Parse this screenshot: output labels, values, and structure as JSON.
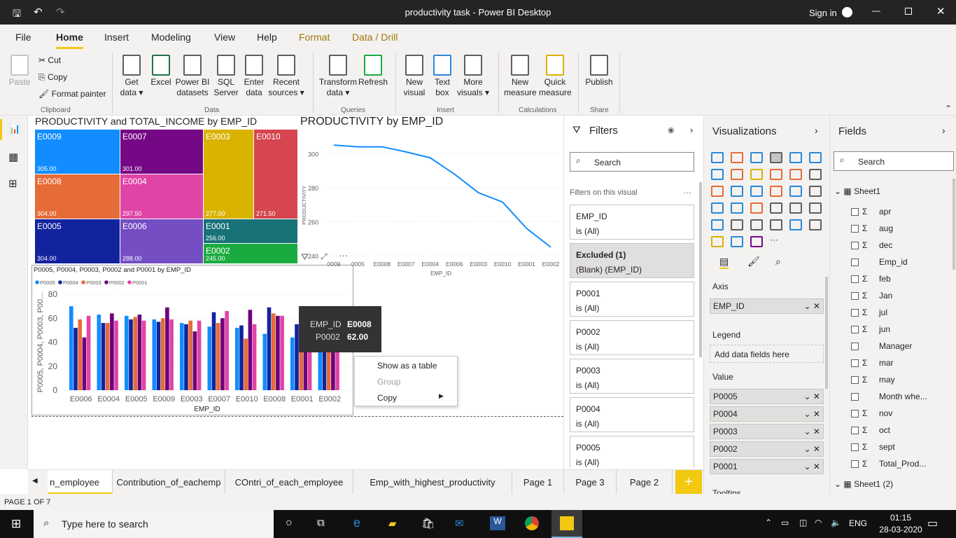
{
  "window": {
    "title": "productivity task - Power BI Desktop",
    "sign_in": "Sign in"
  },
  "tabs": [
    "File",
    "Home",
    "Insert",
    "Modeling",
    "View",
    "Help",
    "Format",
    "Data / Drill"
  ],
  "ribbon": {
    "clipboard": {
      "paste": "Paste",
      "cut": "Cut",
      "copy": "Copy",
      "format_painter": "Format painter",
      "group": "Clipboard"
    },
    "data": {
      "items": [
        "Get data",
        "Excel",
        "Power BI datasets",
        "SQL Server",
        "Enter data",
        "Recent sources"
      ],
      "group": "Data"
    },
    "queries": {
      "items": [
        "Transform data",
        "Refresh"
      ],
      "group": "Queries"
    },
    "insert": {
      "items": [
        "New visual",
        "Text box",
        "More visuals"
      ],
      "group": "Insert"
    },
    "calculations": {
      "items": [
        "New measure",
        "Quick measure"
      ],
      "group": "Calculations"
    },
    "share": {
      "items": [
        "Publish"
      ],
      "group": "Share"
    }
  },
  "treemap": {
    "title": "PRODUCTIVITY and TOTAL_INCOME by EMP_ID",
    "tiles": [
      {
        "id": "E0009",
        "value": "305.00",
        "color": "#118dff"
      },
      {
        "id": "E0007",
        "value": "301.00",
        "color": "#750985"
      },
      {
        "id": "E0003",
        "value": "277.00",
        "color": "#d9b300"
      },
      {
        "id": "E0010",
        "value": "271.50",
        "color": "#d64550"
      },
      {
        "id": "E0008",
        "value": "304.00",
        "color": "#e66c37"
      },
      {
        "id": "E0004",
        "value": "297.50",
        "color": "#e044a7"
      },
      {
        "id": "E0001",
        "value": "256.00",
        "color": "#197278"
      },
      {
        "id": "E0005",
        "value": "304.00",
        "color": "#12239e"
      },
      {
        "id": "E0006",
        "value": "288.00",
        "color": "#744ec2"
      },
      {
        "id": "E0002",
        "value": "245.00",
        "color": "#1aab40"
      }
    ]
  },
  "chart_data": [
    {
      "type": "line",
      "title": "PRODUCTIVITY by EMP_ID",
      "xlabel": "EMP_ID",
      "ylabel": "PRODUCTIVITY",
      "categories": [
        "E0009",
        "E0005",
        "E0008",
        "E0007",
        "E0004",
        "E0006",
        "E0003",
        "E0010",
        "E0001",
        "E0002"
      ],
      "tick_labels": [
        "0009",
        "0005",
        "E0008",
        "E0007",
        "E0004",
        "E0006",
        "E0003",
        "E0010",
        "E0001",
        "E0002"
      ],
      "values": [
        305,
        304,
        304,
        301,
        297.5,
        288,
        277,
        271.5,
        256,
        245
      ],
      "ylim": [
        240,
        310
      ],
      "yticks": [
        "240",
        "260",
        "280",
        "300"
      ],
      "grid": true,
      "color": "#118dff"
    },
    {
      "type": "bar",
      "title": "P0005, P0004, P0003, P0002 and P0001 by EMP_ID",
      "xlabel": "EMP_ID",
      "ylabel": "P0005, P0004, P0003, P00...",
      "categories": [
        "E0006",
        "E0004",
        "E0005",
        "E0009",
        "E0003",
        "E0007",
        "E0010",
        "E0008",
        "E0001",
        "E0002"
      ],
      "ylim": [
        0,
        80
      ],
      "yticks": [
        "0",
        "20",
        "40",
        "60",
        "80"
      ],
      "grid": true,
      "legend": "top-left",
      "series": [
        {
          "name": "P0005",
          "color": "#118dff",
          "values": [
            70,
            63,
            62,
            59,
            56,
            53,
            52,
            47,
            44,
            45
          ]
        },
        {
          "name": "P0004",
          "color": "#12239e",
          "values": [
            52,
            56,
            59,
            57,
            55,
            65,
            54,
            69,
            55,
            52
          ]
        },
        {
          "name": "P0003",
          "color": "#e66c37",
          "values": [
            59,
            56,
            61,
            60,
            58,
            56,
            43,
            64,
            50,
            50
          ]
        },
        {
          "name": "P0002",
          "color": "#6b007b",
          "values": [
            44,
            64,
            63,
            69,
            49,
            60,
            67,
            62,
            57,
            56
          ]
        },
        {
          "name": "P0001",
          "color": "#e044a7",
          "values": [
            62,
            58,
            58,
            59,
            58,
            66,
            55,
            62,
            55,
            54
          ]
        }
      ]
    }
  ],
  "tooltip": {
    "k1": "EMP_ID",
    "v1": "E0008",
    "k2": "P0002",
    "v2": "62.00"
  },
  "context_menu": [
    "Show as a table",
    "Group",
    "Copy"
  ],
  "filters": {
    "title": "Filters",
    "search": "Search",
    "section": "Filters on this visual",
    "cards": [
      {
        "name": "EMP_ID",
        "value": "is (All)"
      },
      {
        "name": "Excluded (1)",
        "value": "(Blank) (EMP_ID)"
      },
      {
        "name": "P0001",
        "value": "is (All)"
      },
      {
        "name": "P0002",
        "value": "is (All)"
      },
      {
        "name": "P0003",
        "value": "is (All)"
      },
      {
        "name": "P0004",
        "value": "is (All)"
      },
      {
        "name": "P0005",
        "value": "is (All)"
      }
    ]
  },
  "visualizations": {
    "title": "Visualizations",
    "axis": "Axis",
    "axis_field": "EMP_ID",
    "legend": "Legend",
    "legend_placeholder": "Add data fields here",
    "value": "Value",
    "values": [
      "P0005",
      "P0004",
      "P0003",
      "P0002",
      "P0001"
    ],
    "tooltips": "Tooltips"
  },
  "fields": {
    "title": "Fields",
    "search": "Search",
    "table": "Sheet1",
    "table2": "Sheet1 (2)",
    "items": [
      {
        "name": "apr",
        "sigma": true
      },
      {
        "name": "aug",
        "sigma": true
      },
      {
        "name": "dec",
        "sigma": true
      },
      {
        "name": "Emp_id",
        "sigma": false
      },
      {
        "name": "feb",
        "sigma": true
      },
      {
        "name": "Jan",
        "sigma": true
      },
      {
        "name": "jul",
        "sigma": true
      },
      {
        "name": "jun",
        "sigma": true
      },
      {
        "name": "Manager",
        "sigma": false
      },
      {
        "name": "mar",
        "sigma": true
      },
      {
        "name": "may",
        "sigma": true
      },
      {
        "name": "Month whe...",
        "sigma": false
      },
      {
        "name": "nov",
        "sigma": true
      },
      {
        "name": "oct",
        "sigma": true
      },
      {
        "name": "sept",
        "sigma": true
      },
      {
        "name": "Total_Prod...",
        "sigma": true
      }
    ]
  },
  "pages": [
    "n_employee",
    "Contribution_of_eachemp",
    "COntri_of_each_employee",
    "Emp_with_highest_productivity",
    "Page 1",
    "Page 3",
    "Page 2"
  ],
  "add_page": "+",
  "status": "PAGE 1 OF 7",
  "taskbar": {
    "search": "Type here to search",
    "lang": "ENG",
    "time": "01:15",
    "date": "28-03-2020"
  }
}
